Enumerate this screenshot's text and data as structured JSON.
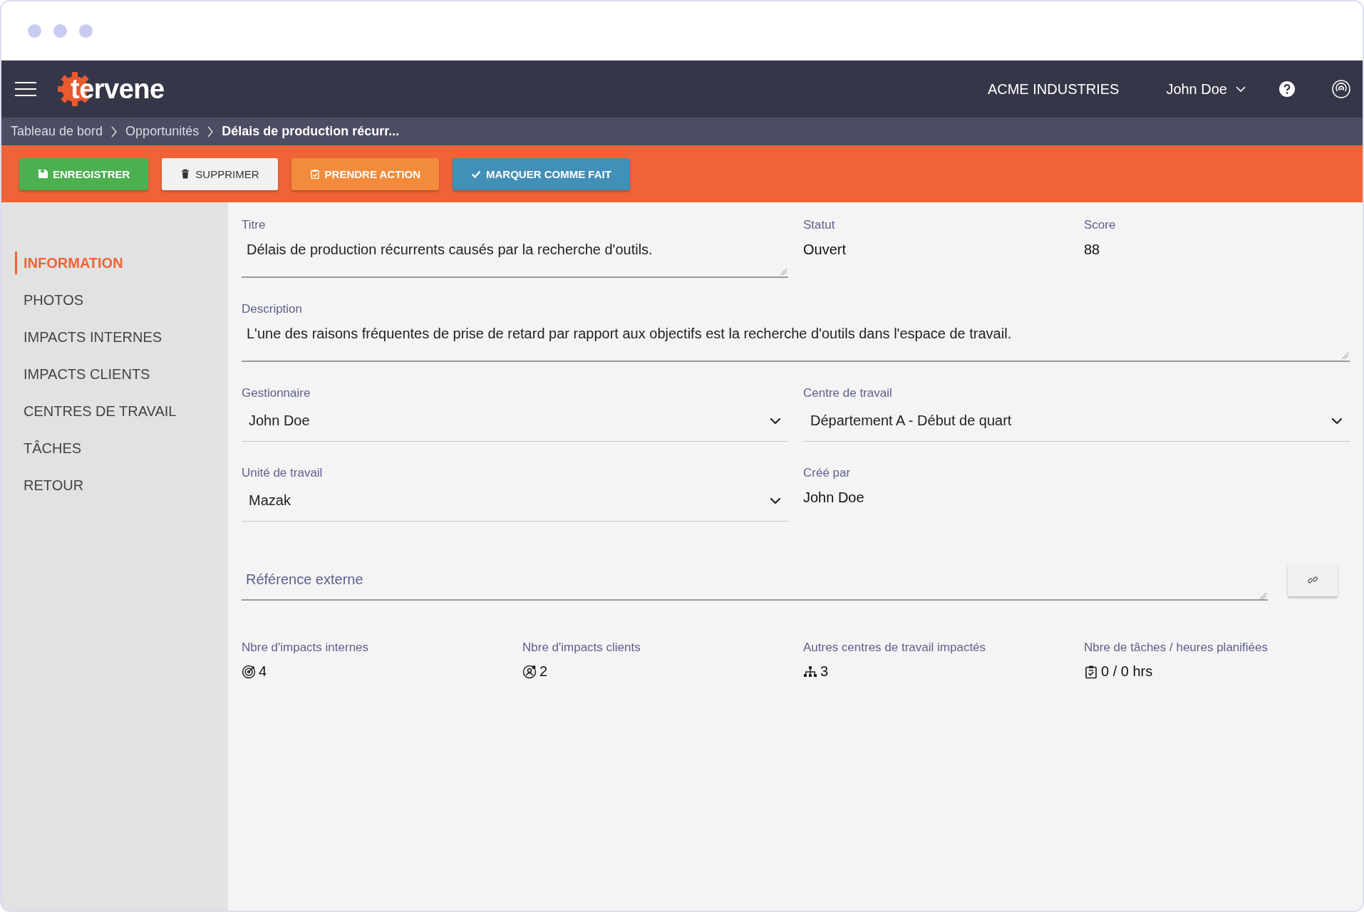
{
  "header": {
    "logo": "tervene",
    "company": "ACME INDUSTRIES",
    "user": "John Doe"
  },
  "breadcrumb": [
    {
      "label": "Tableau de bord",
      "current": false
    },
    {
      "label": "Opportunités",
      "current": false
    },
    {
      "label": "Délais de production récurr...",
      "current": true
    }
  ],
  "toolbar": [
    {
      "label": "ENREGISTRER",
      "kind": "save"
    },
    {
      "label": "SUPPRIMER",
      "kind": "delete"
    },
    {
      "label": "PRENDRE ACTION",
      "kind": "action"
    },
    {
      "label": "MARQUER COMME FAIT",
      "kind": "done"
    }
  ],
  "sidebar": {
    "items": [
      {
        "label": "INFORMATION",
        "selected": true
      },
      {
        "label": "PHOTOS",
        "selected": false
      },
      {
        "label": "IMPACTS INTERNES",
        "selected": false
      },
      {
        "label": "IMPACTS CLIENTS",
        "selected": false
      },
      {
        "label": "CENTRES DE TRAVAIL",
        "selected": false
      },
      {
        "label": "TÂCHES",
        "selected": false
      },
      {
        "label": "RETOUR",
        "selected": false
      }
    ]
  },
  "form": {
    "fields": [
      {
        "kind": "textarea",
        "label": "Titre",
        "value": "Délais de production récurrents causés par la recherche d'outils."
      },
      {
        "kind": "text",
        "label": "Statut",
        "value": "Ouvert"
      },
      {
        "kind": "text",
        "label": "Score",
        "value": "88"
      },
      {
        "kind": "textarea",
        "label": "Description",
        "value": "L'une des raisons fréquentes de prise de retard par rapport aux objectifs est la recherche d'outils dans l'espace de travail."
      },
      {
        "kind": "select",
        "label": "Gestionnaire",
        "value": "John Doe"
      },
      {
        "kind": "select",
        "label": "Centre de travail",
        "value": "Département A - Début de quart"
      },
      {
        "kind": "select",
        "label": "Unité de travail",
        "value": "Mazak"
      },
      {
        "kind": "text",
        "label": "Créé par",
        "value": "John Doe"
      },
      {
        "kind": "link",
        "placeholder": "Référence externe"
      }
    ]
  },
  "stats": [
    {
      "kind": "internal",
      "label": "Nbre d'impacts internes",
      "value": "4"
    },
    {
      "kind": "client",
      "label": "Nbre d'impacts clients",
      "value": "2"
    },
    {
      "kind": "workcenters",
      "label": "Autres centres de travail impactés",
      "value": "3"
    },
    {
      "kind": "tasks",
      "label": "Nbre de tâches / heures planifiées",
      "value": "0 / 0 hrs"
    }
  ]
}
